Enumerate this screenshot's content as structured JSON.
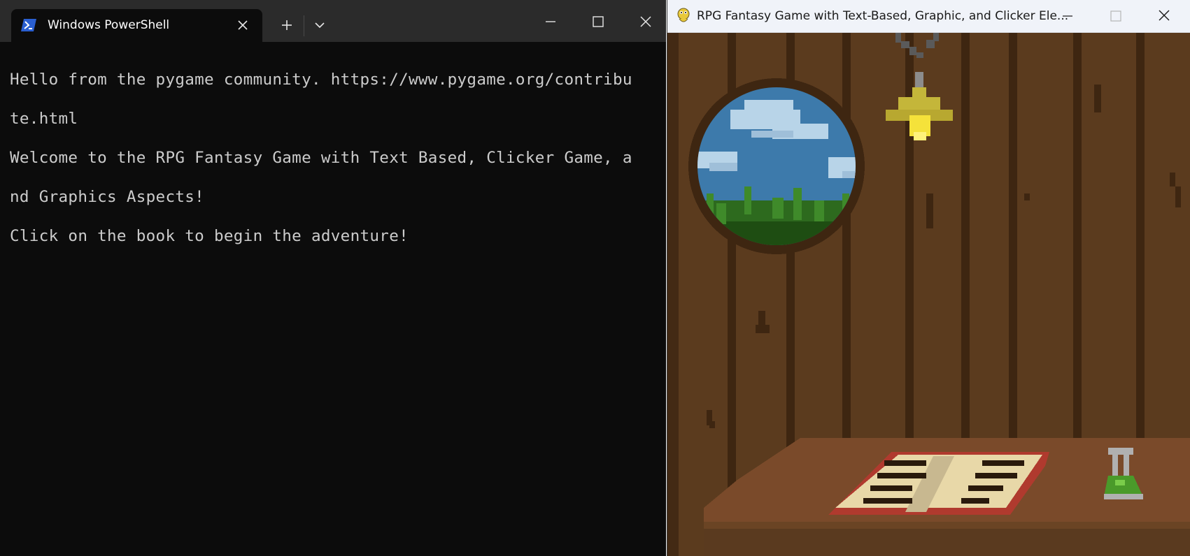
{
  "terminal": {
    "tab_title": "Windows PowerShell",
    "tab_icon": "powershell-icon",
    "output_lines": [
      "Hello from the pygame community. https://www.pygame.org/contribu",
      "te.html",
      "Welcome to the RPG Fantasy Game with Text Based, Clicker Game, a",
      "nd Graphics Aspects!",
      "Click on the book to begin the adventure!"
    ],
    "colors": {
      "background": "#0c0c0c",
      "text": "#cccccc",
      "titlebar": "#2b2b2b"
    }
  },
  "game_window": {
    "title": "RPG Fantasy Game with Text-Based, Graphic, and Clicker Ele...",
    "app_icon": "pygame-snake-icon",
    "scene": {
      "objects": [
        "round-window",
        "hanging-lamp",
        "table",
        "open-book",
        "green-potion-flask"
      ],
      "colors": {
        "wall": "#5b3b1e",
        "plank_line": "#3e2611",
        "table": "#7a4a2a",
        "sky": "#3d7aab"
      }
    }
  }
}
